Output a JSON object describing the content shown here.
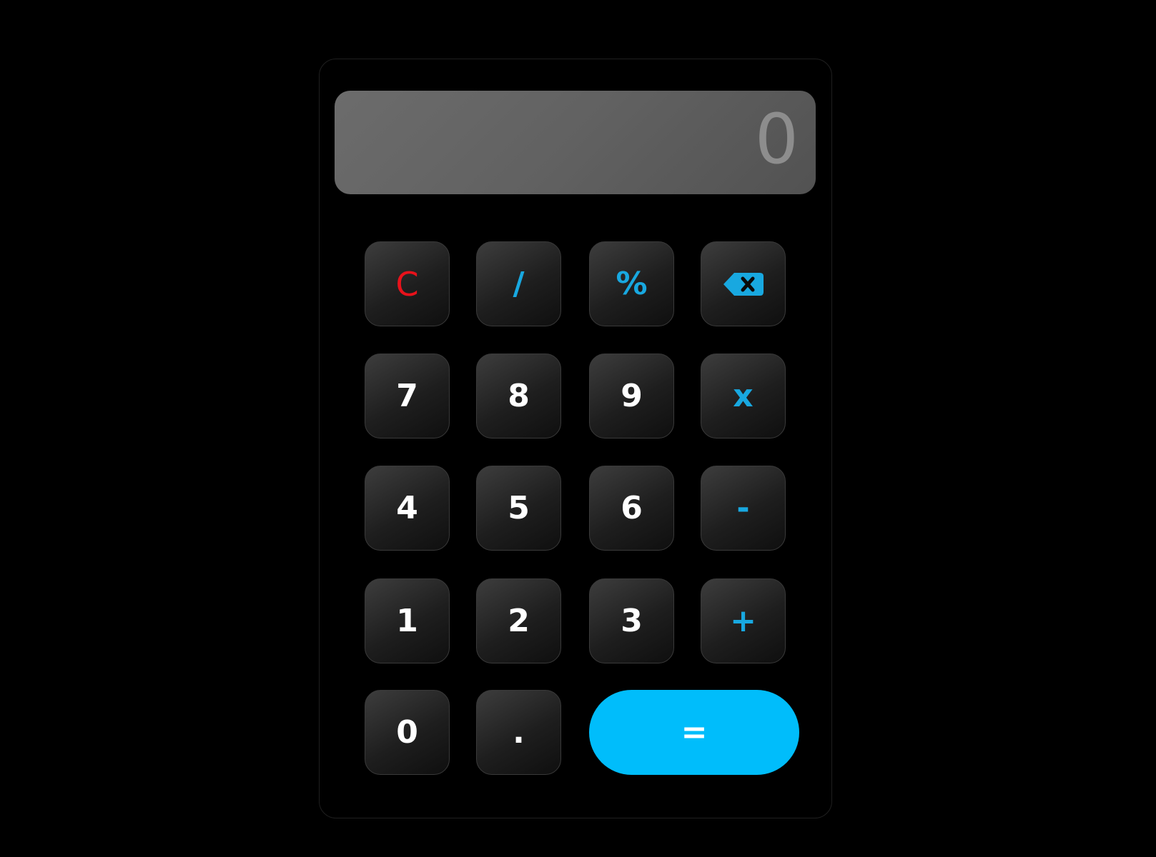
{
  "display": {
    "value": "0"
  },
  "keys": {
    "clear": "C",
    "divide": "/",
    "percent": "%",
    "backspace_icon": "backspace-icon",
    "seven": "7",
    "eight": "8",
    "nine": "9",
    "multiply": "x",
    "four": "4",
    "five": "5",
    "six": "6",
    "minus": "-",
    "one": "1",
    "two": "2",
    "three": "3",
    "plus": "+",
    "zero": "0",
    "decimal": ".",
    "equals": "="
  },
  "colors": {
    "background": "#000000",
    "accent": "#00bdfb",
    "operator": "#18a8e0",
    "clear": "#e8121b",
    "display_bg": "#646464",
    "display_text": "#8d8d8d"
  }
}
